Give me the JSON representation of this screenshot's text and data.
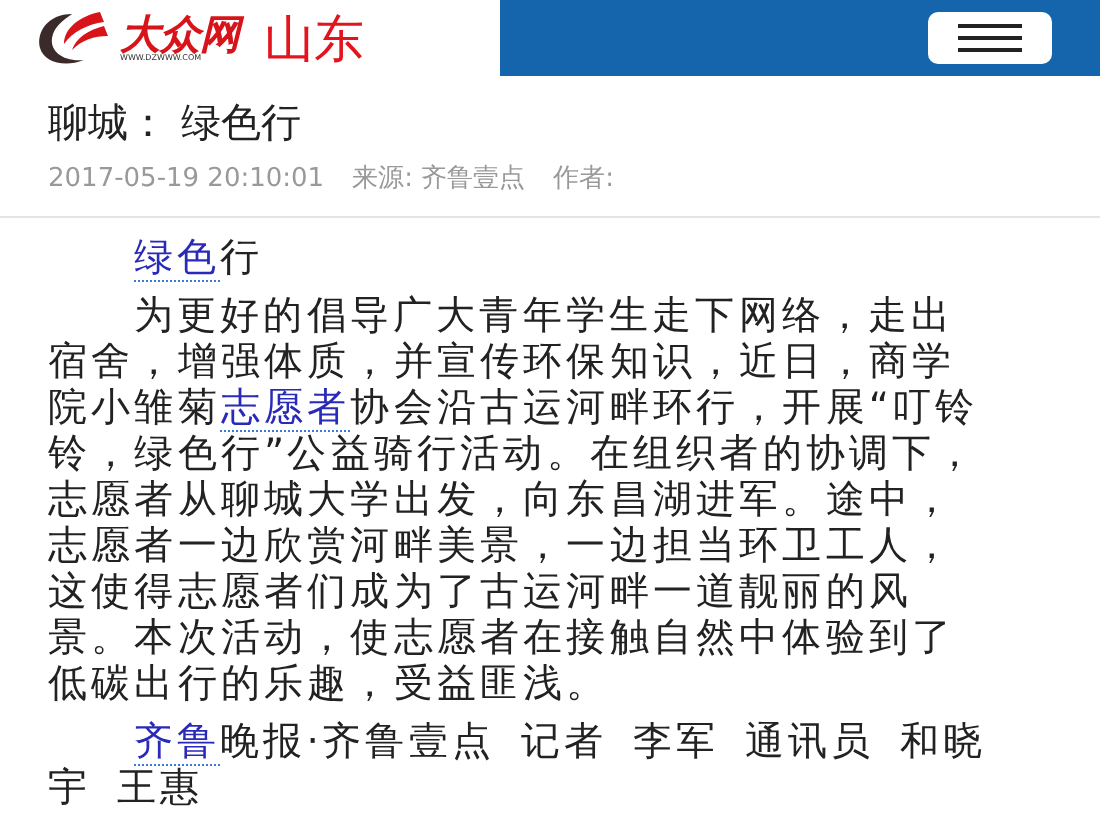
{
  "header": {
    "logo_text": "大众网",
    "logo_url": "WWW.DZWWW.COM",
    "region": "山东"
  },
  "article": {
    "title": "聊城： 绿色行",
    "date": "2017-05-19 20:10:01",
    "source": "来源: 齐鲁壹点",
    "author": "作者:",
    "paragraphs": [
      [
        {
          "text": "绿色",
          "link": true
        },
        {
          "text": "行",
          "link": false
        }
      ],
      [
        {
          "text": "为更好的倡导广大青年学生走下网络，走出宿舍，增强体质，并宣传环保知识，近日，商学院小雏菊",
          "link": false
        },
        {
          "text": "志愿者",
          "link": true
        },
        {
          "text": "协会沿古运河畔环行，开展“叮铃铃，绿色行”公益骑行活动。在组织者的协调下，志愿者从聊城大学出发，向东昌湖进军。途中，志愿者一边欣赏河畔美景，一边担当环卫工人，这使得志愿者们成为了古运河畔一道靓丽的风景。本次活动，使志愿者在接触自然中体验到了低碳出行的乐趣，受益匪浅。",
          "link": false
        }
      ],
      [
        {
          "text": "齐鲁",
          "link": true
        },
        {
          "text": "晚报·齐鲁壹点 记者 李军 通讯员 和晓宇 王惠",
          "link": false
        }
      ]
    ]
  }
}
